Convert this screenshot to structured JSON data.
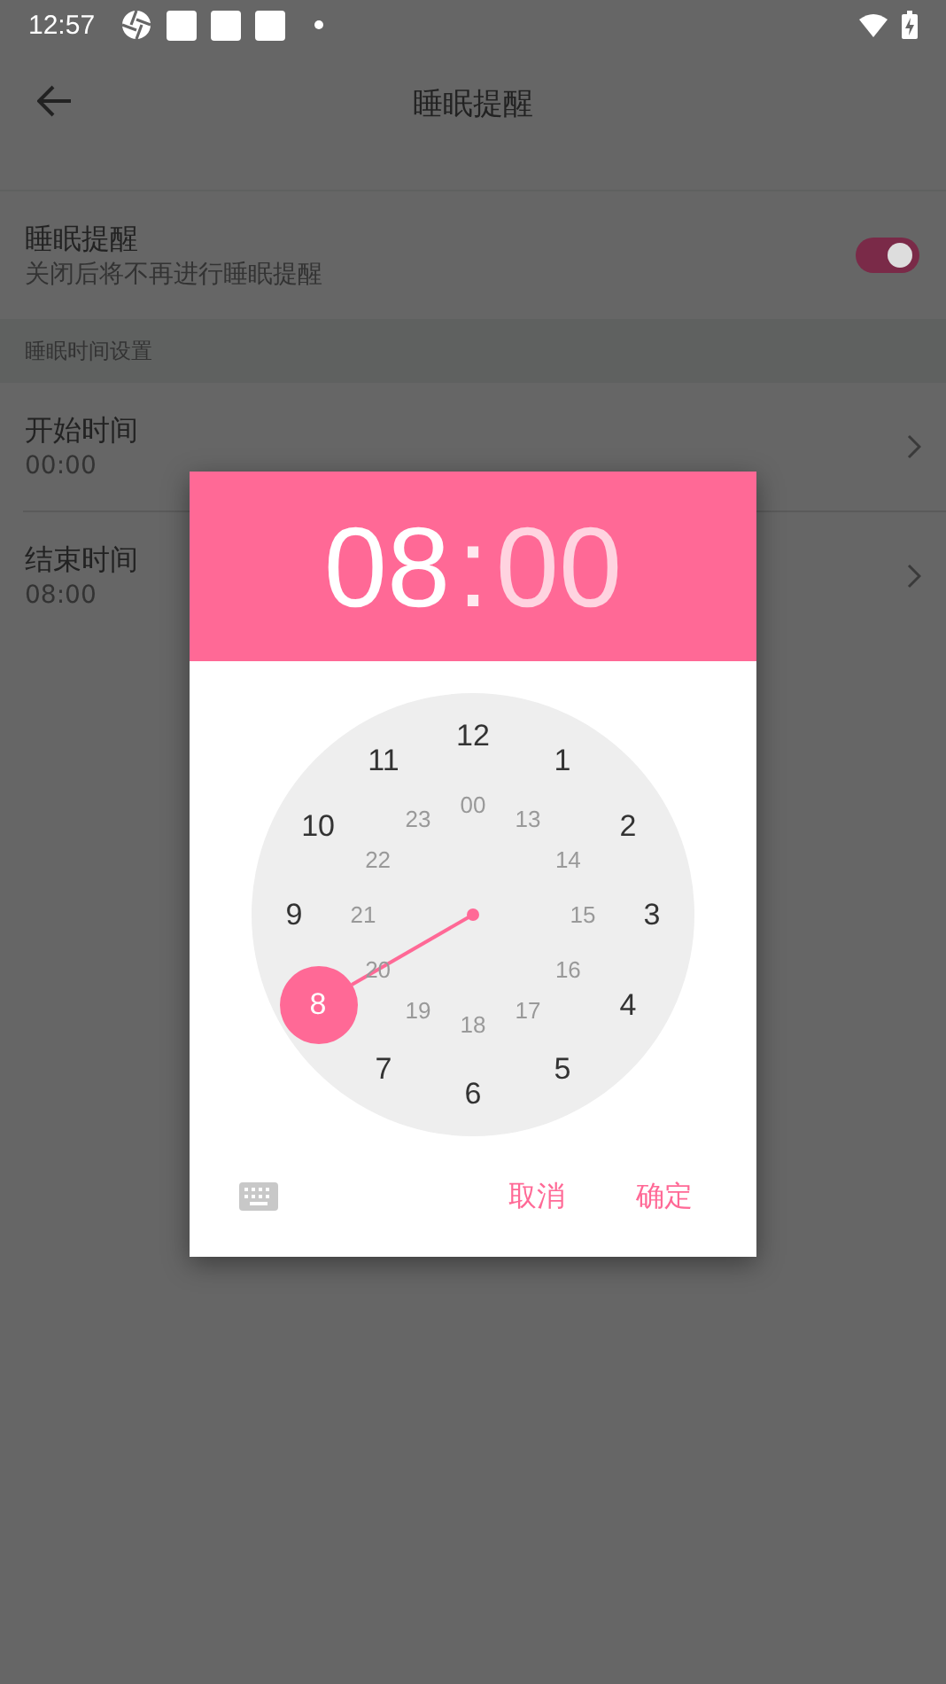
{
  "status_bar": {
    "time": "12:57"
  },
  "app_bar": {
    "title": "睡眠提醒"
  },
  "switch_row": {
    "title": "睡眠提醒",
    "subtitle": "关闭后将不再进行睡眠提醒",
    "on": true
  },
  "section_header": "睡眠时间设置",
  "time_rows": [
    {
      "title": "开始时间",
      "value": "00:00"
    },
    {
      "title": "结束时间",
      "value": "08:00"
    }
  ],
  "dialog": {
    "hour": {
      "text": "08",
      "selected": true
    },
    "separator": ":",
    "minute": {
      "text": "00",
      "selected": false
    },
    "outer_numbers": [
      {
        "label": "12",
        "selected": false
      },
      {
        "label": "1",
        "selected": false
      },
      {
        "label": "2",
        "selected": false
      },
      {
        "label": "3",
        "selected": false
      },
      {
        "label": "4",
        "selected": false
      },
      {
        "label": "5",
        "selected": false
      },
      {
        "label": "6",
        "selected": false
      },
      {
        "label": "7",
        "selected": false
      },
      {
        "label": "8",
        "selected": true
      },
      {
        "label": "9",
        "selected": false
      },
      {
        "label": "10",
        "selected": false
      },
      {
        "label": "11",
        "selected": false
      }
    ],
    "inner_numbers": [
      {
        "label": "00",
        "selected": false
      },
      {
        "label": "13",
        "selected": false
      },
      {
        "label": "14",
        "selected": false
      },
      {
        "label": "15",
        "selected": false
      },
      {
        "label": "16",
        "selected": false
      },
      {
        "label": "17",
        "selected": false
      },
      {
        "label": "18",
        "selected": false
      },
      {
        "label": "19",
        "selected": false
      },
      {
        "label": "20",
        "selected": false
      },
      {
        "label": "21",
        "selected": false
      },
      {
        "label": "22",
        "selected": false
      },
      {
        "label": "23",
        "selected": false
      }
    ],
    "buttons": [
      "取消",
      "确定"
    ]
  }
}
